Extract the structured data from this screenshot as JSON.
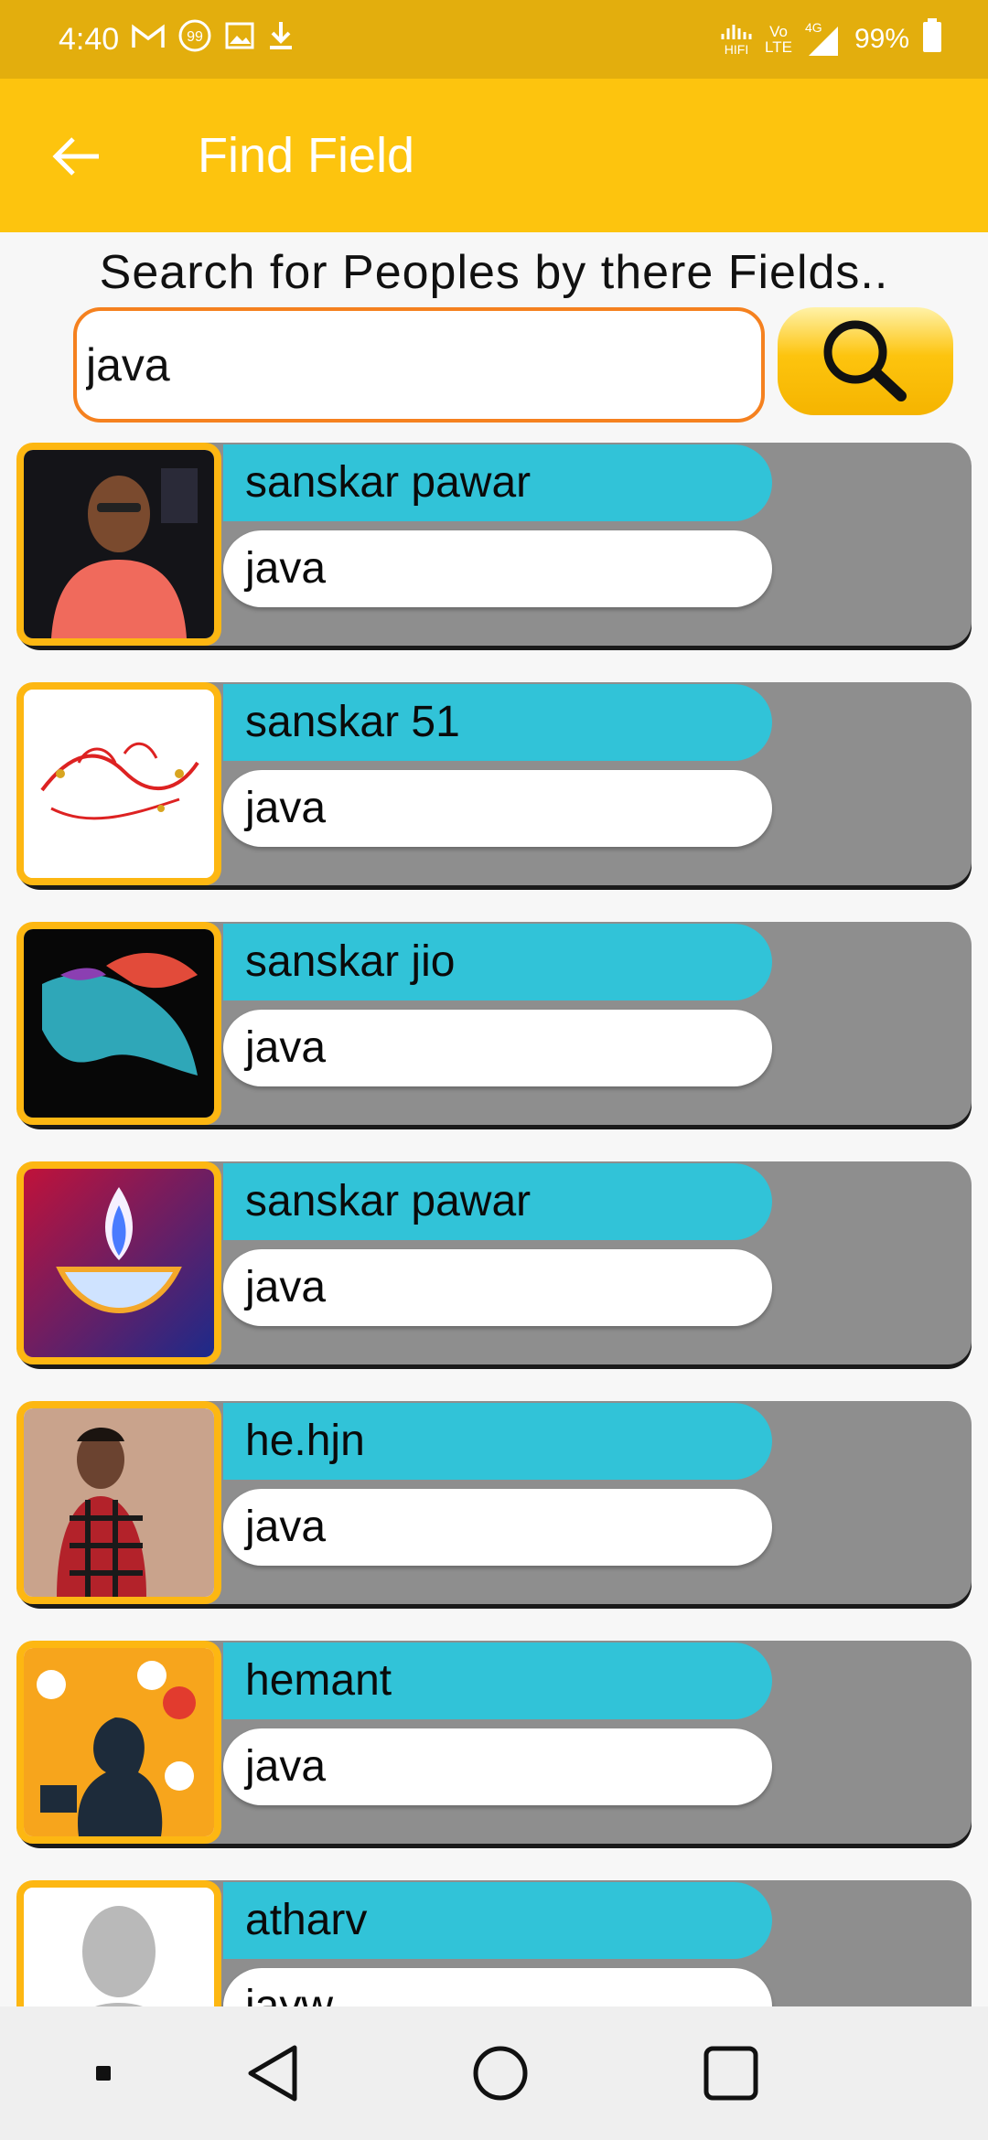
{
  "status_bar": {
    "time": "4:40",
    "battery": "99%",
    "net_label_1": "Vo",
    "net_label_2": "LTE",
    "net_label_3": "4G",
    "hifi_label": "HIFI"
  },
  "app_bar": {
    "title": "Find Field"
  },
  "search": {
    "hint": "Search for Peoples by there Fields..",
    "value": "java"
  },
  "results": [
    {
      "name": "sanskar pawar",
      "field": "java"
    },
    {
      "name": "sanskar 51",
      "field": "java"
    },
    {
      "name": "sanskar jio",
      "field": "java"
    },
    {
      "name": "sanskar pawar",
      "field": "java"
    },
    {
      "name": "he.hjn",
      "field": "java"
    },
    {
      "name": "hemant",
      "field": "java"
    },
    {
      "name": "atharv",
      "field": "jayw"
    }
  ],
  "colors": {
    "status_bar": "#e3ae0d",
    "app_bar": "#fdc40e",
    "name_pill": "#31c3d8",
    "card": "#8e8e8e",
    "accent_border": "#f5811f"
  }
}
